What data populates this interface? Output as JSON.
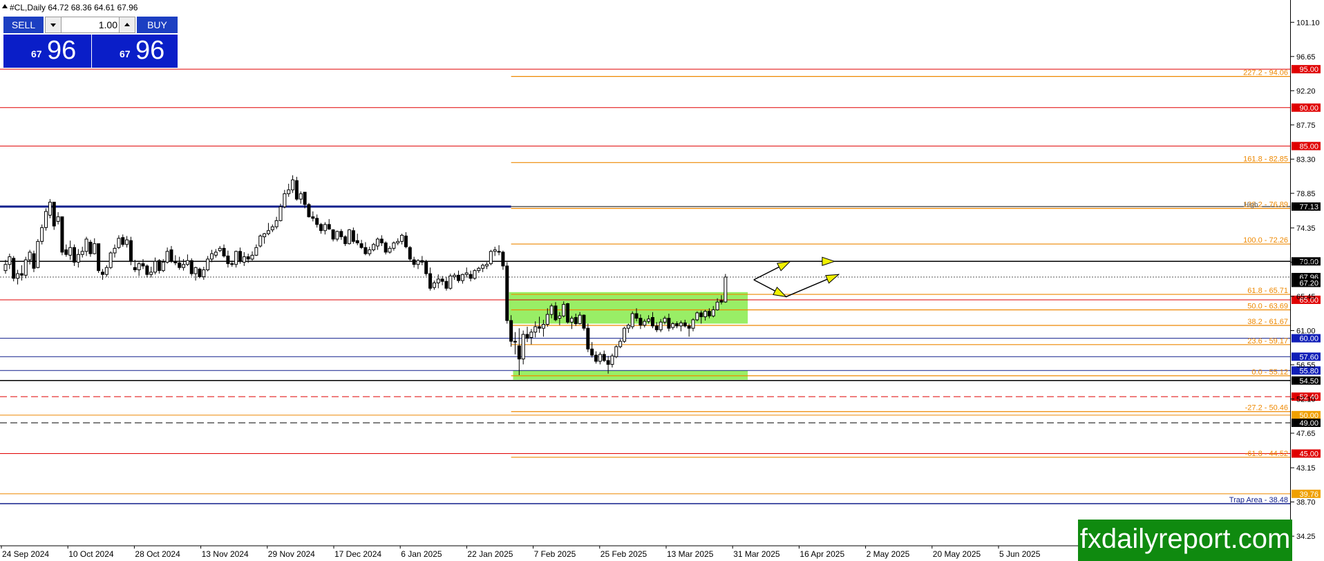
{
  "header": {
    "symbol_label": "#CL,Daily  64.72 68.36 64.61 67.96"
  },
  "trade_panel": {
    "sell_label": "SELL",
    "buy_label": "BUY",
    "lot_value": "1.00",
    "sell_small": "67",
    "sell_big": "96",
    "buy_small": "67",
    "buy_big": "96"
  },
  "watermark": "fxdailyreport.com",
  "colors": {
    "bull_candle": "#ffffff",
    "bear_candle": "#000000",
    "red_level": "#e00000",
    "orange_fib": "#ee8800",
    "navy_level": "#101f8c",
    "zone_fill": "#99ee66",
    "price_tag_red": "#e00000",
    "price_tag_blue": "#101fb8",
    "price_tag_black": "#000000",
    "price_tag_orange": "#f0a000",
    "arrow_fill": "#f0f000"
  },
  "chart_data": {
    "type": "candlestick",
    "symbol": "#CL",
    "timeframe": "Daily",
    "last_bar": {
      "open": 64.72,
      "high": 68.36,
      "low": 64.61,
      "close": 67.96
    },
    "ylim": [
      33.0,
      104.0
    ],
    "y_ticks": [
      "101.10",
      "96.65",
      "92.20",
      "87.75",
      "83.30",
      "78.85",
      "74.35",
      "69.90",
      "65.45",
      "61.00",
      "56.55",
      "52.10",
      "47.65",
      "43.15",
      "38.70",
      "34.25"
    ],
    "x_ticks": [
      "24 Sep 2024",
      "10 Oct 2024",
      "28 Oct 2024",
      "13 Nov 2024",
      "29 Nov 2024",
      "17 Dec 2024",
      "6 Jan 2025",
      "22 Jan 2025",
      "7 Feb 2025",
      "25 Feb 2025",
      "13 Mar 2025",
      "31 Mar 2025",
      "16 Apr 2025",
      "2 May 2025",
      "20 May 2025",
      "5 Jun 2025"
    ],
    "candles": [
      [
        68.8,
        70.2,
        68.4,
        69.6
      ],
      [
        69.6,
        71.0,
        69.0,
        70.6
      ],
      [
        70.4,
        70.7,
        67.4,
        67.8
      ],
      [
        67.8,
        68.9,
        67.0,
        68.4
      ],
      [
        68.4,
        69.5,
        67.5,
        68.2
      ],
      [
        68.2,
        70.6,
        67.8,
        70.2
      ],
      [
        70.2,
        71.5,
        69.6,
        71.2
      ],
      [
        71.0,
        71.4,
        68.6,
        69.1
      ],
      [
        69.2,
        72.9,
        69.1,
        72.6
      ],
      [
        72.6,
        74.8,
        72.2,
        74.4
      ],
      [
        74.4,
        76.9,
        74.0,
        76.5
      ],
      [
        76.0,
        78.1,
        75.6,
        77.7
      ],
      [
        77.7,
        77.6,
        74.1,
        74.6
      ],
      [
        75.2,
        76.4,
        74.8,
        75.8
      ],
      [
        75.8,
        75.8,
        70.8,
        71.2
      ],
      [
        71.5,
        72.2,
        70.6,
        70.9
      ],
      [
        70.8,
        72.7,
        70.2,
        71.8
      ],
      [
        71.8,
        72.2,
        69.4,
        69.9
      ],
      [
        69.9,
        71.6,
        69.2,
        70.9
      ],
      [
        70.9,
        71.9,
        70.5,
        71.3
      ],
      [
        71.3,
        73.2,
        70.7,
        72.9
      ],
      [
        72.5,
        72.8,
        70.6,
        71.0
      ],
      [
        71.0,
        73.0,
        70.9,
        72.3
      ],
      [
        72.3,
        72.3,
        68.5,
        68.8
      ],
      [
        68.6,
        69.0,
        67.6,
        68.3
      ],
      [
        68.3,
        69.5,
        68.0,
        69.2
      ],
      [
        69.2,
        71.3,
        69.0,
        71.1
      ],
      [
        71.1,
        72.2,
        70.5,
        71.7
      ],
      [
        71.8,
        73.4,
        71.6,
        73.0
      ],
      [
        73.1,
        73.5,
        71.9,
        72.2
      ],
      [
        72.2,
        73.3,
        71.8,
        72.8
      ],
      [
        72.7,
        73.2,
        69.5,
        70.0
      ],
      [
        69.2,
        70.2,
        68.6,
        68.9
      ],
      [
        68.9,
        69.9,
        68.1,
        69.7
      ],
      [
        69.7,
        70.3,
        69.0,
        69.4
      ],
      [
        69.4,
        69.6,
        67.9,
        68.3
      ],
      [
        68.3,
        69.3,
        67.9,
        68.6
      ],
      [
        68.6,
        70.5,
        68.3,
        70.0
      ],
      [
        70.1,
        70.3,
        68.4,
        68.8
      ],
      [
        68.8,
        70.3,
        68.6,
        69.9
      ],
      [
        69.9,
        71.8,
        69.7,
        71.3
      ],
      [
        71.5,
        72.0,
        69.8,
        70.0
      ],
      [
        70.0,
        70.8,
        69.5,
        69.8
      ],
      [
        69.8,
        70.6,
        68.9,
        69.2
      ],
      [
        69.2,
        70.3,
        68.8,
        69.6
      ],
      [
        69.6,
        70.9,
        69.4,
        70.1
      ],
      [
        70.1,
        70.4,
        68.1,
        68.4
      ],
      [
        68.4,
        69.3,
        67.5,
        69.2
      ],
      [
        69.0,
        69.2,
        67.8,
        68.0
      ],
      [
        68.0,
        69.3,
        67.6,
        68.9
      ],
      [
        68.9,
        70.7,
        68.7,
        70.3
      ],
      [
        70.3,
        71.5,
        69.9,
        71.0
      ],
      [
        70.8,
        71.6,
        70.5,
        71.2
      ],
      [
        71.4,
        72.0,
        71.2,
        71.7
      ],
      [
        71.7,
        72.2,
        70.5,
        70.7
      ],
      [
        70.7,
        71.4,
        69.2,
        69.7
      ],
      [
        69.7,
        70.1,
        69.3,
        69.6
      ],
      [
        69.6,
        71.4,
        69.2,
        71.3
      ],
      [
        71.3,
        71.8,
        69.7,
        70.0
      ],
      [
        69.9,
        71.2,
        69.4,
        70.6
      ],
      [
        70.6,
        71.0,
        69.8,
        70.3
      ],
      [
        70.3,
        71.3,
        70.1,
        70.8
      ],
      [
        70.8,
        72.2,
        70.7,
        71.8
      ],
      [
        72.0,
        73.5,
        71.8,
        73.3
      ],
      [
        73.2,
        73.7,
        72.3,
        73.6
      ],
      [
        73.6,
        75.0,
        73.4,
        74.0
      ],
      [
        74.1,
        74.8,
        73.8,
        74.5
      ],
      [
        74.5,
        75.8,
        74.2,
        75.3
      ],
      [
        75.3,
        77.5,
        75.2,
        77.1
      ],
      [
        77.1,
        79.3,
        76.9,
        78.8
      ],
      [
        78.8,
        80.1,
        78.4,
        79.3
      ],
      [
        79.3,
        81.2,
        78.9,
        80.6
      ],
      [
        80.5,
        81.0,
        77.9,
        78.1
      ],
      [
        78.1,
        79.1,
        77.5,
        78.8
      ],
      [
        79.0,
        79.0,
        76.9,
        77.4
      ],
      [
        77.4,
        77.6,
        75.7,
        75.8
      ],
      [
        75.8,
        76.5,
        75.2,
        75.6
      ],
      [
        75.6,
        76.1,
        74.4,
        74.8
      ],
      [
        74.8,
        75.0,
        73.6,
        74.0
      ],
      [
        74.0,
        75.1,
        73.5,
        74.8
      ],
      [
        74.8,
        75.5,
        74.1,
        74.2
      ],
      [
        74.1,
        74.2,
        72.6,
        72.9
      ],
      [
        72.9,
        74.0,
        72.6,
        73.9
      ],
      [
        73.9,
        74.2,
        72.8,
        73.2
      ],
      [
        73.2,
        73.4,
        72.0,
        72.3
      ],
      [
        72.3,
        74.2,
        72.2,
        74.1
      ],
      [
        74.0,
        74.4,
        72.3,
        72.6
      ],
      [
        72.7,
        73.6,
        72.1,
        72.4
      ],
      [
        72.3,
        72.8,
        71.6,
        71.8
      ],
      [
        71.8,
        72.5,
        70.8,
        71.0
      ],
      [
        71.0,
        71.9,
        70.7,
        71.5
      ],
      [
        71.5,
        72.4,
        71.3,
        72.2
      ],
      [
        72.0,
        73.1,
        71.5,
        72.9
      ],
      [
        72.9,
        73.4,
        72.0,
        72.4
      ],
      [
        72.4,
        72.6,
        70.9,
        71.2
      ],
      [
        71.2,
        72.0,
        71.0,
        71.7
      ],
      [
        71.7,
        72.6,
        71.4,
        72.4
      ],
      [
        72.4,
        73.0,
        72.1,
        72.6
      ],
      [
        72.6,
        73.6,
        72.2,
        73.4
      ],
      [
        73.3,
        73.8,
        71.7,
        71.9
      ],
      [
        71.8,
        72.0,
        70.1,
        70.3
      ],
      [
        70.2,
        70.6,
        69.2,
        69.6
      ],
      [
        69.6,
        70.3,
        69.0,
        70.1
      ],
      [
        70.1,
        70.7,
        69.5,
        69.9
      ],
      [
        69.9,
        70.2,
        68.1,
        68.4
      ],
      [
        68.4,
        69.2,
        66.2,
        66.5
      ],
      [
        66.6,
        67.5,
        66.3,
        67.2
      ],
      [
        67.2,
        68.3,
        66.5,
        67.7
      ],
      [
        67.7,
        68.1,
        66.9,
        67.4
      ],
      [
        67.4,
        68.0,
        66.2,
        66.5
      ],
      [
        66.5,
        68.4,
        66.3,
        68.1
      ],
      [
        68.0,
        68.5,
        67.6,
        68.2
      ],
      [
        68.2,
        68.8,
        67.2,
        67.5
      ],
      [
        67.5,
        68.4,
        67.1,
        68.3
      ],
      [
        68.3,
        69.2,
        67.9,
        68.5
      ],
      [
        68.3,
        68.8,
        67.4,
        67.8
      ],
      [
        67.8,
        69.0,
        67.6,
        68.8
      ],
      [
        68.8,
        69.3,
        68.5,
        69.1
      ],
      [
        69.1,
        69.7,
        68.6,
        69.5
      ],
      [
        69.4,
        69.9,
        69.0,
        69.6
      ],
      [
        69.7,
        71.5,
        69.5,
        71.3
      ],
      [
        71.3,
        71.9,
        70.7,
        71.5
      ],
      [
        71.3,
        72.1,
        70.8,
        71.2
      ],
      [
        71.2,
        71.4,
        68.9,
        69.4
      ],
      [
        69.4,
        69.9,
        61.9,
        62.3
      ],
      [
        62.3,
        63.0,
        58.9,
        59.6
      ],
      [
        59.6,
        60.8,
        57.9,
        59.5
      ],
      [
        59.0,
        61.3,
        55.2,
        57.3
      ],
      [
        57.3,
        61.0,
        56.6,
        60.5
      ],
      [
        60.5,
        61.5,
        59.5,
        60.0
      ],
      [
        60.1,
        61.2,
        59.2,
        60.8
      ],
      [
        60.8,
        62.2,
        60.1,
        61.5
      ],
      [
        61.5,
        62.8,
        60.7,
        61.3
      ],
      [
        61.3,
        62.4,
        60.2,
        61.8
      ],
      [
        61.8,
        63.9,
        61.5,
        63.1
      ],
      [
        63.1,
        64.5,
        62.6,
        64.2
      ],
      [
        64.2,
        64.7,
        62.2,
        62.4
      ],
      [
        62.6,
        63.4,
        61.7,
        62.9
      ],
      [
        62.9,
        64.8,
        62.7,
        64.4
      ],
      [
        64.5,
        64.6,
        61.9,
        62.1
      ],
      [
        62.1,
        62.9,
        61.2,
        62.6
      ],
      [
        62.7,
        63.2,
        61.6,
        61.9
      ],
      [
        61.9,
        63.4,
        61.8,
        63.0
      ],
      [
        63.0,
        63.1,
        61.0,
        61.3
      ],
      [
        61.3,
        61.9,
        58.2,
        58.6
      ],
      [
        58.6,
        59.5,
        57.5,
        57.8
      ],
      [
        57.8,
        58.3,
        56.7,
        57.0
      ],
      [
        57.0,
        58.2,
        56.6,
        57.9
      ],
      [
        57.9,
        58.4,
        56.9,
        57.1
      ],
      [
        57.1,
        57.7,
        55.4,
        56.6
      ],
      [
        56.6,
        58.0,
        56.2,
        57.7
      ],
      [
        57.6,
        59.1,
        57.4,
        58.9
      ],
      [
        58.9,
        59.9,
        58.7,
        59.6
      ],
      [
        59.6,
        61.5,
        59.4,
        61.3
      ],
      [
        61.3,
        61.9,
        60.7,
        61.7
      ],
      [
        61.5,
        63.5,
        61.2,
        63.2
      ],
      [
        63.2,
        63.9,
        62.2,
        62.6
      ],
      [
        62.6,
        63.1,
        61.2,
        61.7
      ],
      [
        61.7,
        62.5,
        61.4,
        62.2
      ],
      [
        62.2,
        63.0,
        61.9,
        62.5
      ],
      [
        62.7,
        63.4,
        61.3,
        61.6
      ],
      [
        61.6,
        62.1,
        60.8,
        61.1
      ],
      [
        61.1,
        62.5,
        60.8,
        62.1
      ],
      [
        62.1,
        62.9,
        61.8,
        62.6
      ],
      [
        62.6,
        63.2,
        60.9,
        61.3
      ],
      [
        61.4,
        62.1,
        61.1,
        61.9
      ],
      [
        61.9,
        62.2,
        61.3,
        61.6
      ],
      [
        61.6,
        62.3,
        60.9,
        62.0
      ],
      [
        62.0,
        62.4,
        61.4,
        61.6
      ],
      [
        61.6,
        61.9,
        60.2,
        61.3
      ],
      [
        61.3,
        62.6,
        60.9,
        62.4
      ],
      [
        62.4,
        63.5,
        62.2,
        63.3
      ],
      [
        63.3,
        63.6,
        61.9,
        62.8
      ],
      [
        62.8,
        63.7,
        62.3,
        63.5
      ],
      [
        63.5,
        63.9,
        62.6,
        62.9
      ],
      [
        62.9,
        64.2,
        62.7,
        63.7
      ],
      [
        63.7,
        65.2,
        63.6,
        64.7
      ],
      [
        64.9,
        65.6,
        64.4,
        64.7
      ],
      [
        64.72,
        68.36,
        64.61,
        67.96
      ]
    ],
    "levels": [
      {
        "price": 95.0,
        "label": "95.00",
        "color": "red"
      },
      {
        "price": 90.0,
        "label": "90.00",
        "color": "red"
      },
      {
        "price": 85.0,
        "label": "85.00",
        "color": "red"
      },
      {
        "price": 77.13,
        "label": "77.13",
        "color": "navy"
      },
      {
        "price": 70.0,
        "label": "70.00",
        "color": "black"
      },
      {
        "price": 65.0,
        "label": "65.00",
        "color": "red"
      },
      {
        "price": 60.0,
        "label": "60.00",
        "color": "blue"
      },
      {
        "price": 57.6,
        "label": "57.60",
        "color": "blue"
      },
      {
        "price": 55.8,
        "label": "55.80",
        "color": "blue"
      },
      {
        "price": 54.5,
        "label": "54.50",
        "color": "black"
      },
      {
        "price": 52.4,
        "label": "52.40",
        "color": "red-dashed"
      },
      {
        "price": 50.0,
        "label": "50.00",
        "color": "orange"
      },
      {
        "price": 49.0,
        "label": "49.00",
        "color": "black-dashed"
      },
      {
        "price": 45.0,
        "label": "45.00",
        "color": "red"
      },
      {
        "price": 39.76,
        "label": "39.76",
        "color": "orange"
      }
    ],
    "fib_levels": [
      {
        "price": 94.06,
        "label": "227.2 - 94.06"
      },
      {
        "price": 82.85,
        "label": "161.8 - 82.85"
      },
      {
        "price": 76.89,
        "label": "138.2 - 76.89"
      },
      {
        "price": 72.26,
        "label": "100.0 - 72.26"
      },
      {
        "price": 65.71,
        "label": "61.8 - 65.71"
      },
      {
        "price": 63.69,
        "label": "50.0 - 63.69"
      },
      {
        "price": 61.67,
        "label": "38.2 - 61.67"
      },
      {
        "price": 59.17,
        "label": "23.6 - 59.17"
      },
      {
        "price": 55.12,
        "label": "0.0 - 55.12"
      },
      {
        "price": 50.46,
        "label": "-27.2 - 50.46"
      },
      {
        "price": 44.52,
        "label": "-61.8 - 44.52"
      }
    ],
    "trap_area": {
      "price": 38.48,
      "label": "Trap Area - 38.48"
    },
    "high_label": "High",
    "current_prices": [
      {
        "price": 67.96,
        "label": "67.96"
      },
      {
        "price": 67.2,
        "label": "67.20"
      }
    ],
    "zone_upper": {
      "from_bar": 125,
      "to_bar": 183,
      "top": 66.0,
      "bottom": 61.9
    },
    "zone_lower": {
      "from_bar": 126,
      "to_bar": 183,
      "top": 55.8,
      "bottom": 54.6
    },
    "projection_arrows": [
      {
        "points": [
          [
            185,
            67.6
          ],
          [
            194,
            70.0
          ],
          [
            205,
            70.0
          ]
        ]
      },
      {
        "points": [
          [
            185,
            67.6
          ],
          [
            193,
            65.4
          ],
          [
            206,
            68.3
          ]
        ]
      }
    ]
  }
}
